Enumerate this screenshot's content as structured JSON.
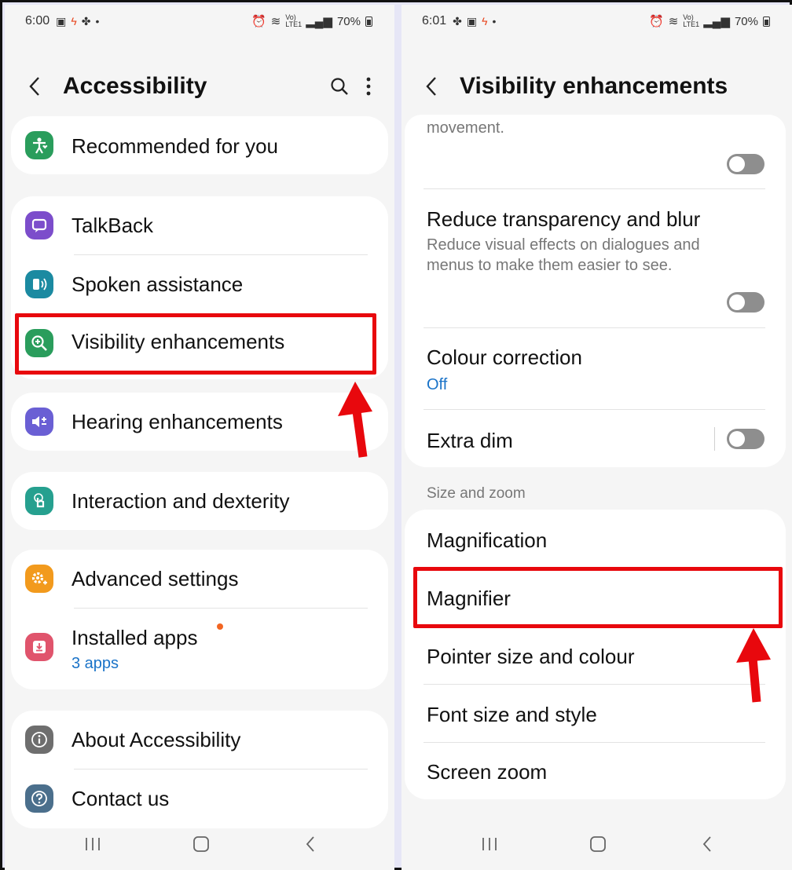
{
  "left": {
    "status": {
      "time": "6:00",
      "battery": "70%",
      "net": "Vo) LTE1"
    },
    "title": "Accessibility",
    "items": [
      {
        "label": "Recommended for you",
        "icon": "person-heart-icon"
      },
      {
        "label": "TalkBack",
        "icon": "talkback-icon"
      },
      {
        "label": "Spoken assistance",
        "icon": "spoken-assistance-icon"
      },
      {
        "label": "Visibility enhancements",
        "icon": "magnify-plus-icon"
      },
      {
        "label": "Hearing enhancements",
        "icon": "speaker-plus-icon"
      },
      {
        "label": "Interaction and dexterity",
        "icon": "touch-hand-icon"
      },
      {
        "label": "Advanced settings",
        "icon": "gear-plus-icon"
      },
      {
        "label": "Installed apps",
        "sub": "3 apps",
        "icon": "download-icon"
      },
      {
        "label": "About Accessibility",
        "icon": "info-icon"
      },
      {
        "label": "Contact us",
        "icon": "question-icon"
      }
    ]
  },
  "right": {
    "status": {
      "time": "6:01",
      "battery": "70%",
      "net": "Vo) LTE1"
    },
    "title": "Visibility enhancements",
    "partial_text": "movement.",
    "reduce_transparency": {
      "label": "Reduce transparency and blur",
      "desc": "Reduce visual effects on dialogues and menus to make them easier to see."
    },
    "colour_correction": {
      "label": "Colour correction",
      "value": "Off"
    },
    "extra_dim": {
      "label": "Extra dim"
    },
    "section_label": "Size and zoom",
    "zoom_items": [
      "Magnification",
      "Magnifier",
      "Pointer size and colour",
      "Font size and style",
      "Screen zoom"
    ]
  },
  "colors": {
    "highlight": "#e8080d",
    "link": "#1a73c8",
    "toggle_off": "#8e8e8e"
  }
}
